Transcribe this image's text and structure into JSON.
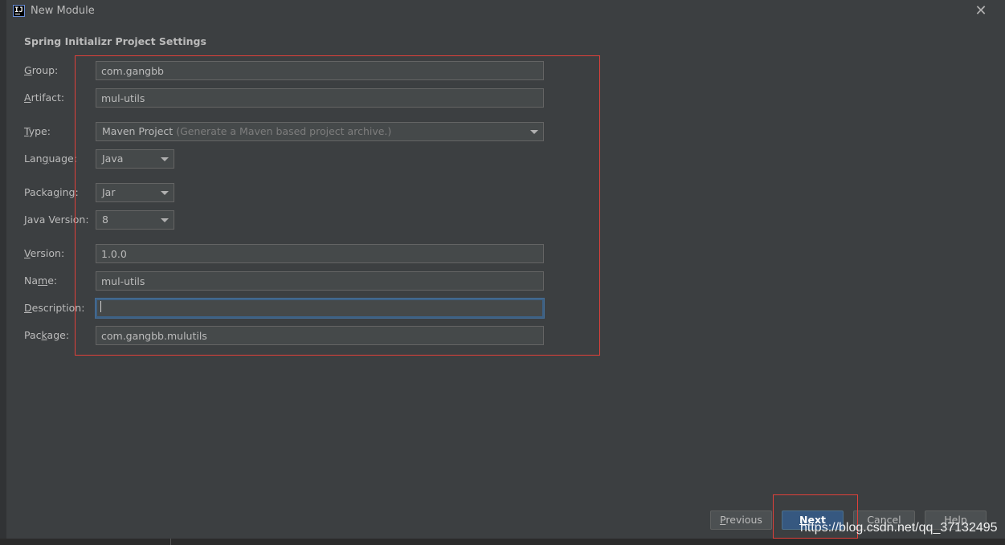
{
  "window": {
    "title": "New Module",
    "icon": "intellij-app-icon",
    "icon_text": "IJ"
  },
  "section_title": "Spring Initializr Project Settings",
  "form": {
    "group": {
      "label_pre": "",
      "label_mnemonic": "G",
      "label_post": "roup:",
      "value": "com.gangbb"
    },
    "artifact": {
      "label_pre": "",
      "label_mnemonic": "A",
      "label_post": "rtifact:",
      "value": "mul-utils"
    },
    "type": {
      "label_pre": "",
      "label_mnemonic": "T",
      "label_post": "ype:",
      "value": "Maven Project",
      "hint": "(Generate a Maven based project archive.)"
    },
    "language": {
      "label_pre": "Lan",
      "label_mnemonic": "g",
      "label_post": "uage:",
      "value": "Java"
    },
    "packaging": {
      "label_pre": "Packa",
      "label_mnemonic": "g",
      "label_post": "ing:",
      "value": "Jar"
    },
    "java_version": {
      "label_pre": "",
      "label_mnemonic": "J",
      "label_post": "ava Version:",
      "value": "8"
    },
    "version": {
      "label_pre": "",
      "label_mnemonic": "V",
      "label_post": "ersion:",
      "value": "1.0.0"
    },
    "name": {
      "label_pre": "Na",
      "label_mnemonic": "m",
      "label_post": "e:",
      "value": "mul-utils"
    },
    "description": {
      "label_pre": "",
      "label_mnemonic": "D",
      "label_post": "escription:",
      "value": ""
    },
    "package": {
      "label_pre": "Pac",
      "label_mnemonic": "k",
      "label_post": "age:",
      "value": "com.gangbb.mulutils"
    }
  },
  "buttons": {
    "previous_mnemonic": "P",
    "previous_rest": "revious",
    "next_mnemonic": "N",
    "next_rest": "ext",
    "cancel": "Cancel",
    "help": "Help"
  },
  "watermark": "https://blog.csdn.net/qq_37132495",
  "colors": {
    "background": "#3c3f41",
    "field_bg": "#45494a",
    "annotation_red": "#e0403a",
    "primary_button": "#365880",
    "focus_border": "#3d6185"
  }
}
